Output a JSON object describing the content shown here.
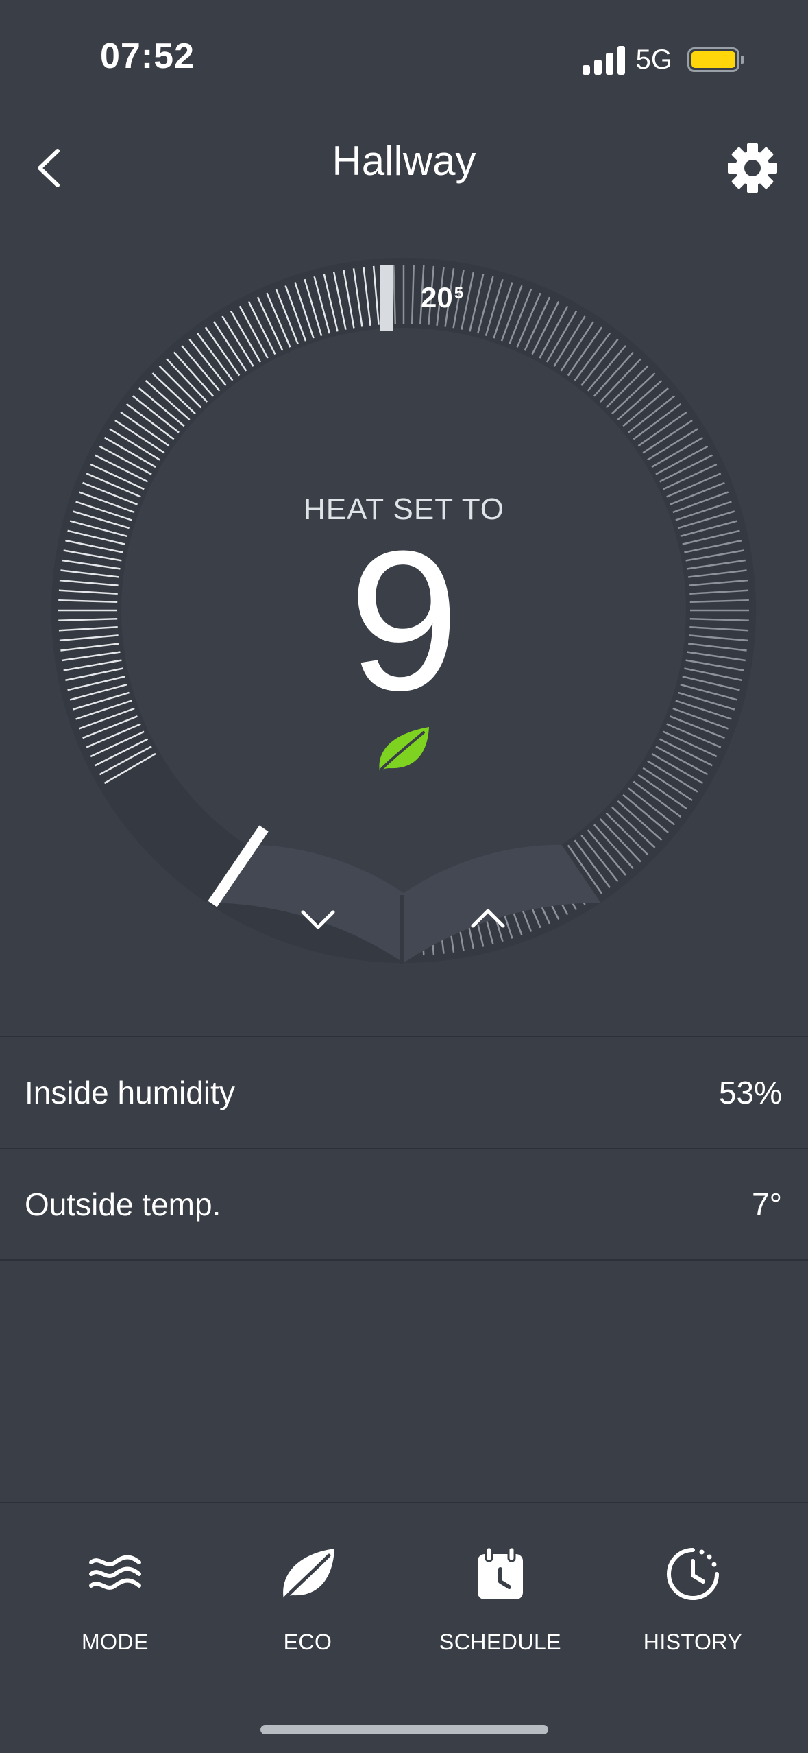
{
  "status_bar": {
    "time": "07:52",
    "network": "5G",
    "battery_color": "#ffd60a"
  },
  "header": {
    "title": "Hallway",
    "back_icon": "chevron-left-icon",
    "settings_icon": "gear-icon"
  },
  "thermostat": {
    "mode_label": "HEAT SET TO",
    "setpoint": "9",
    "current_temp_whole": "20",
    "current_temp_fraction": "5",
    "eco_icon": "leaf-icon",
    "eco_color": "#7ed321",
    "decrease_icon": "chevron-down-icon",
    "increase_icon": "chevron-up-icon"
  },
  "info": [
    {
      "label": "Inside humidity",
      "value": "53%"
    },
    {
      "label": "Outside temp.",
      "value": "7°"
    }
  ],
  "bottom_nav": [
    {
      "label": "MODE",
      "icon": "waves-icon"
    },
    {
      "label": "ECO",
      "icon": "leaf-icon"
    },
    {
      "label": "SCHEDULE",
      "icon": "calendar-clock-icon"
    },
    {
      "label": "HISTORY",
      "icon": "history-icon"
    }
  ]
}
